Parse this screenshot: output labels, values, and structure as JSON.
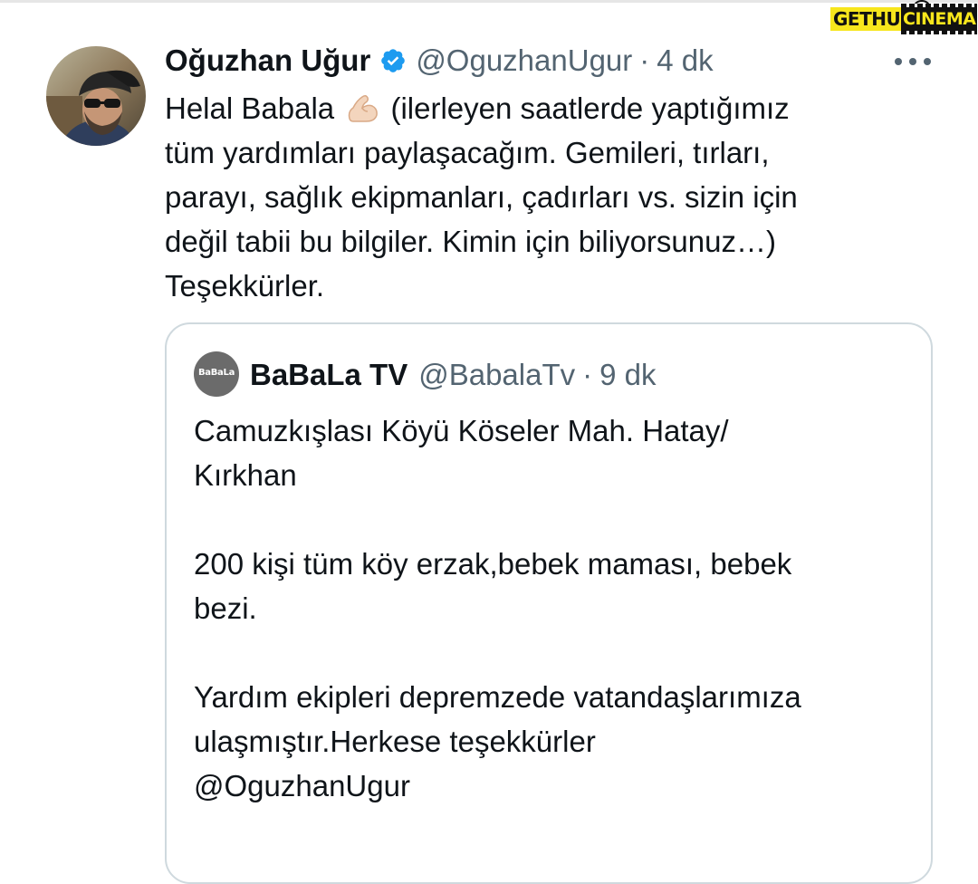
{
  "watermark": {
    "left_text": "GETHU",
    "right_text": "CINEMA"
  },
  "tweet": {
    "display_name": "Oğuzhan Uğur",
    "handle": "@OguzhanUgur",
    "separator": "·",
    "time": "4 dk",
    "text_lines": [
      {
        "before": "Helal Babala",
        "emoji": "flexed-biceps-icon",
        "after": "(ilerleyen saatlerde yaptığımız"
      },
      {
        "text": "tüm yardımları paylaşacağım. Gemileri, tırları,"
      },
      {
        "text": "parayı, sağlık ekipmanları, çadırları vs. sizin için"
      },
      {
        "text": "değil tabii bu bilgiler. Kimin için biliyorsunuz…)"
      },
      {
        "text": "Teşekkürler."
      }
    ]
  },
  "quoted_tweet": {
    "avatar_label": "BaBaLa",
    "display_name": "BaBaLa TV",
    "handle": "@BabalaTv",
    "separator": "·",
    "time": "9 dk",
    "paragraphs": [
      [
        "Camuzkışlası Köyü Köseler Mah. Hatay/",
        "Kırkhan"
      ],
      [
        "200 kişi tüm köy erzak,bebek maması, bebek",
        "bezi."
      ],
      [
        "Yardım ekipleri depremzede vatandaşlarımıza",
        "ulaşmıştır.Herkese teşekkürler",
        "@OguzhanUgur"
      ]
    ]
  },
  "colors": {
    "text_primary": "#0f1419",
    "text_secondary": "#536471",
    "verified_blue": "#1d9bf0",
    "card_border": "#cfd9de"
  }
}
